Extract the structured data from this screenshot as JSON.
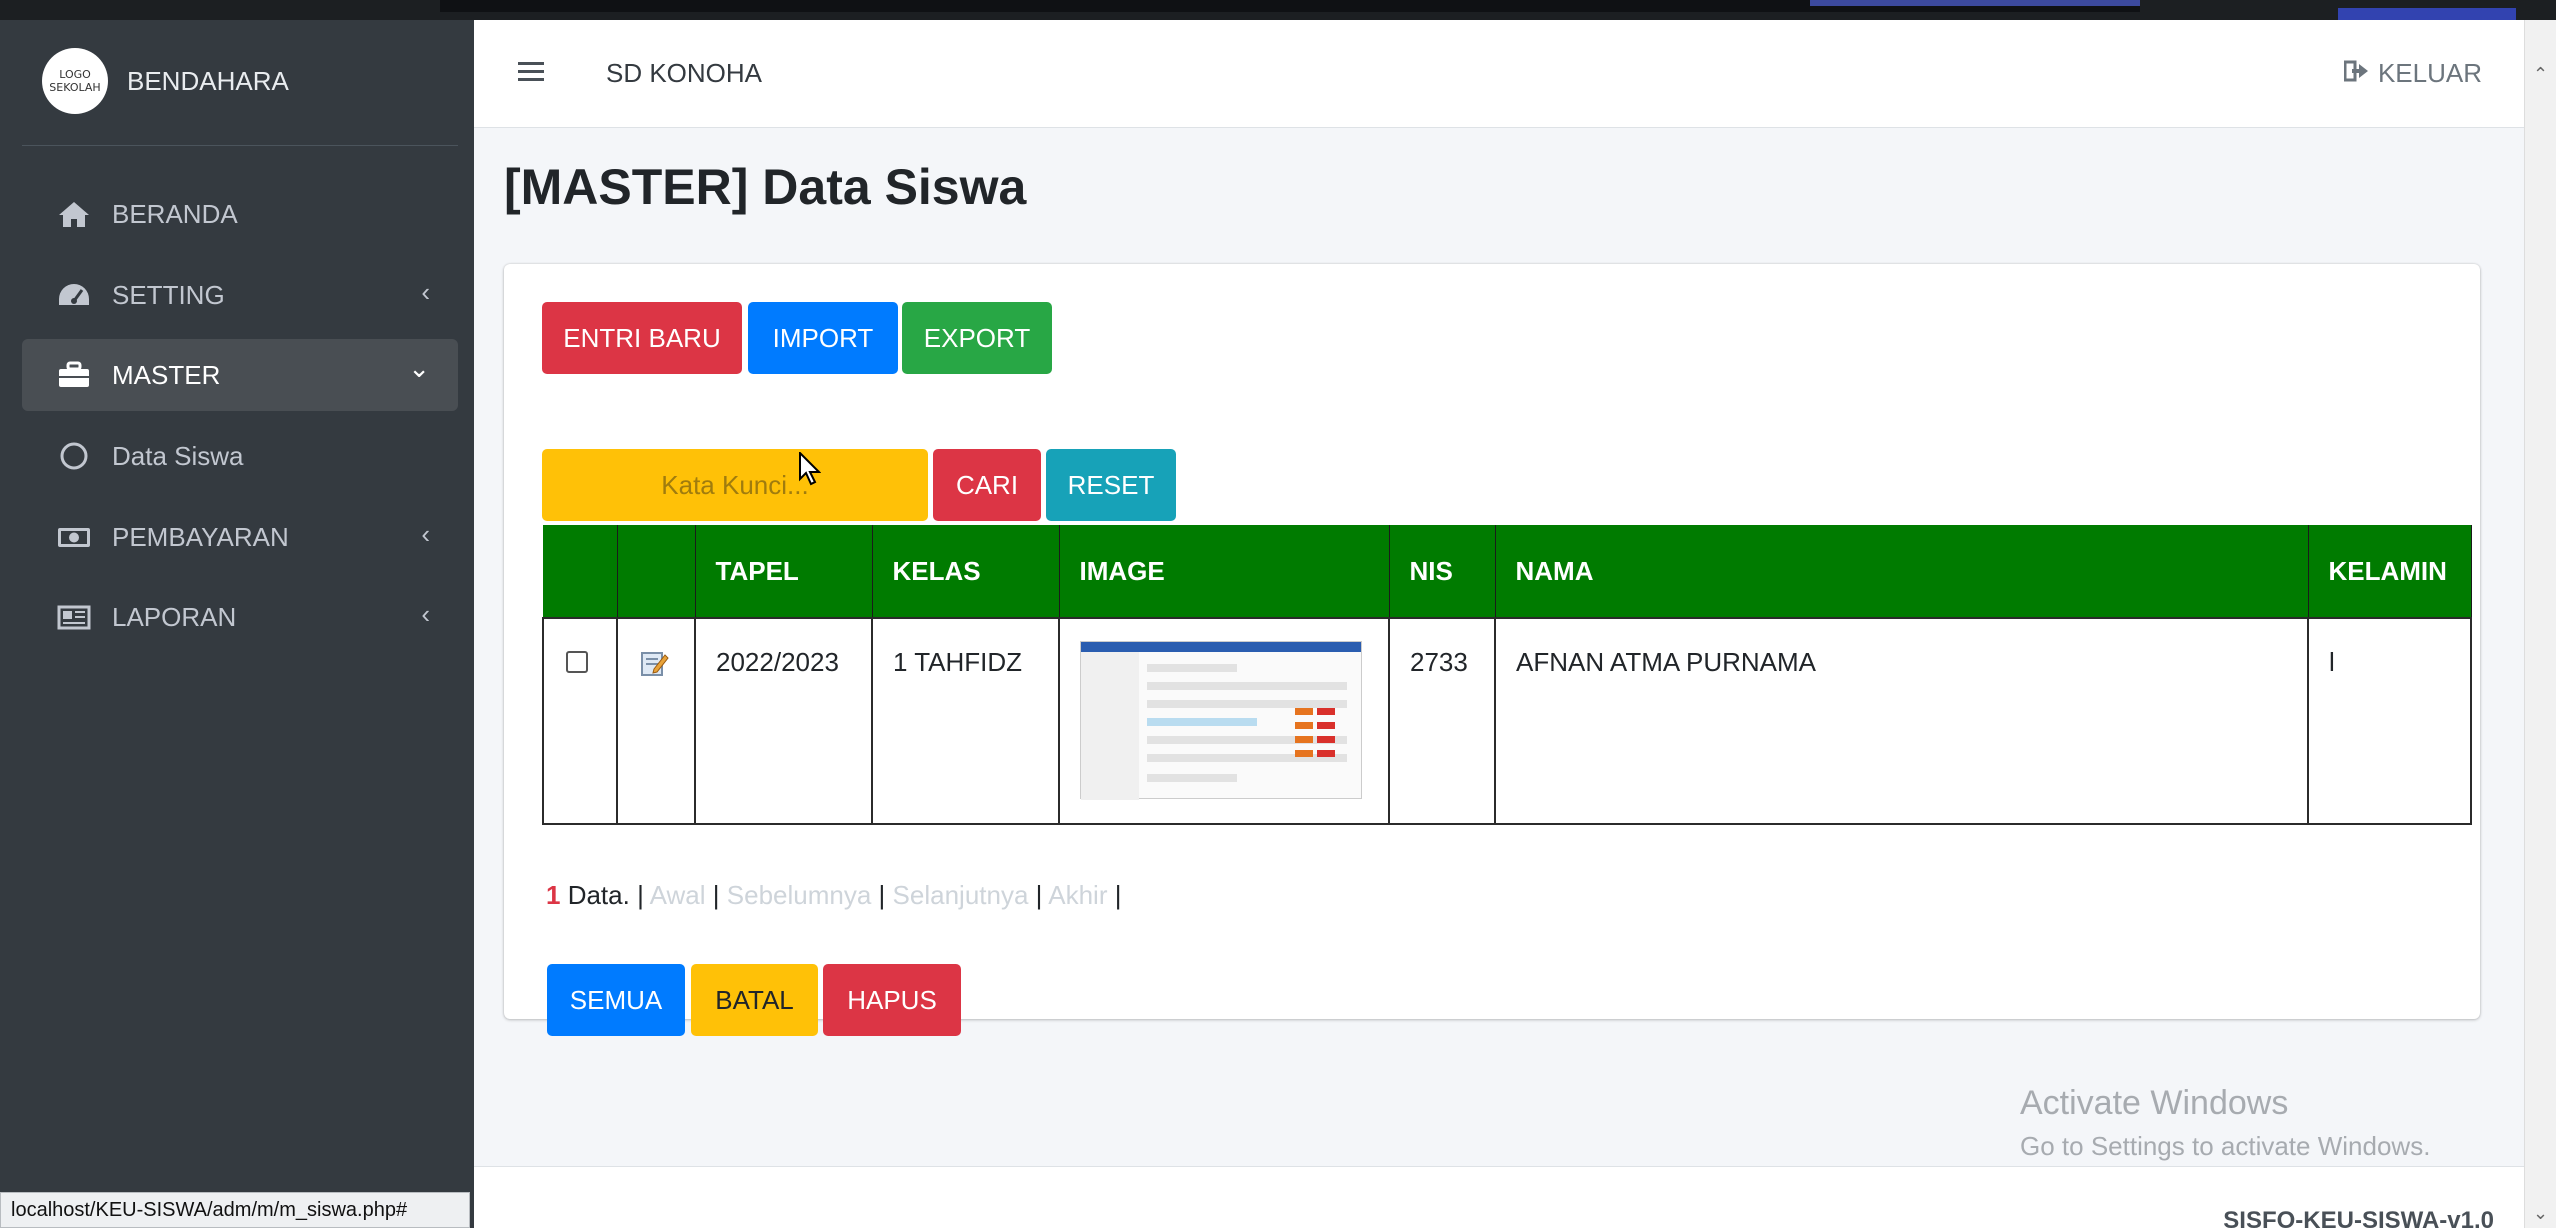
{
  "sidebar": {
    "logo_text": "LOGO SEKOLAH",
    "brand": "BENDAHARA",
    "items": [
      {
        "label": "BERANDA",
        "icon": "home-icon"
      },
      {
        "label": "SETTING",
        "icon": "tachometer-icon"
      },
      {
        "label": "MASTER",
        "icon": "briefcase-icon"
      },
      {
        "label": "Data Siswa",
        "icon": "circle-icon"
      },
      {
        "label": "PEMBAYARAN",
        "icon": "money-icon"
      },
      {
        "label": "LAPORAN",
        "icon": "newspaper-icon"
      }
    ],
    "chevron_left": "‹",
    "chevron_down": "⌄"
  },
  "header": {
    "site_name": "SD KONOHA",
    "logout": "KELUAR"
  },
  "page": {
    "title": "[MASTER] Data Siswa"
  },
  "toolbar": {
    "new": "ENTRI BARU",
    "import": "IMPORT",
    "export": "EXPORT"
  },
  "search": {
    "placeholder": "Kata Kunci...",
    "find": "CARI",
    "reset": "RESET"
  },
  "table": {
    "headers": [
      "",
      "",
      "TAPEL",
      "KELAS",
      "IMAGE",
      "NIS",
      "NAMA",
      "KELAMIN"
    ],
    "rows": [
      {
        "tapel": "2022/2023",
        "kelas": "1 TAHFIDZ",
        "nis": "2733",
        "nama": "AFNAN ATMA PURNAMA",
        "kelamin": "l"
      }
    ]
  },
  "pager": {
    "count": "1",
    "count_label": " Data.",
    "sep": "|",
    "first": "Awal",
    "prev": "Sebelumnya",
    "next": "Selanjutnya",
    "last": "Akhir"
  },
  "actions": {
    "all": "SEMUA",
    "cancel": "BATAL",
    "delete": "HAPUS"
  },
  "footer": {
    "version": "SISFO-KEU-SISWA-v1.0"
  },
  "watermark": {
    "line1": "Activate Windows",
    "line2": "Go to Settings to activate Windows."
  },
  "status_bar": {
    "url": "localhost/KEU-SISWA/adm/m/m_siswa.php#"
  },
  "colors": {
    "sidebar_bg": "#343a40",
    "table_header": "#007b00",
    "danger": "#dc3545",
    "primary": "#007bff",
    "success": "#28a745",
    "warning": "#ffc107",
    "info": "#17a2b8"
  }
}
